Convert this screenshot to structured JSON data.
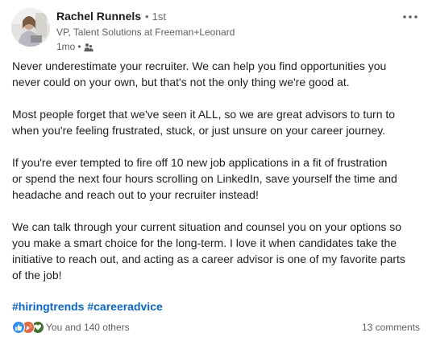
{
  "author": {
    "name": "Rachel Runnels",
    "separator": "•",
    "degree": "1st",
    "headline": "VP, Talent Solutions at Freeman+Leonard",
    "posted": "1mo",
    "meta_separator": "•",
    "visibility_icon": "people-icon"
  },
  "menu": {
    "icon": "more-options-icon"
  },
  "post": {
    "paragraphs": [
      "Never underestimate your recruiter. We can help you find opportunities you\nnever could on your own, but that's not the only thing we're good at.",
      "Most people forget that we've seen it ALL, so we are great advisors to turn to\nwhen you're feeling frustrated, stuck, or just unsure on your career journey.",
      "If you're ever tempted to fire off 10 new job applications in a fit of frustration\nor spend the next four hours scrolling on LinkedIn, save yourself the time and\nheadache and reach out to your recruiter instead!",
      "We can talk through your current situation and counsel you on your options so\nyou make a smart choice for the long-term. I love it when candidates take the\ninitiative to reach out, and acting as a career advisor is one of my favorite parts\nof the job!"
    ],
    "hashtags": [
      "#hiringtrends",
      "#careeradvice"
    ]
  },
  "social": {
    "reaction_icons": [
      "like-icon",
      "celebrate-icon",
      "support-icon"
    ],
    "reactions_text": "You and 140 others",
    "comments_text": "13 comments"
  },
  "colors": {
    "link": "#0a66c2",
    "like": "#378fe9",
    "celebrate": "#e06847",
    "support": "#44712e"
  }
}
